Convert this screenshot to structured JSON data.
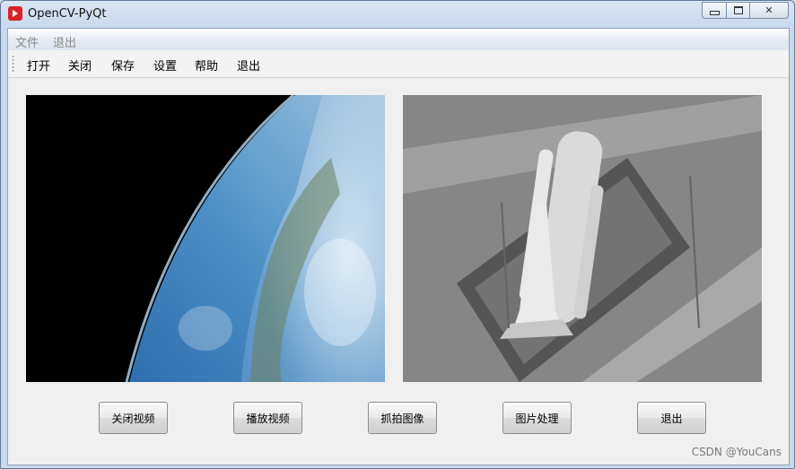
{
  "window": {
    "title": "OpenCV-PyQt"
  },
  "menubar": {
    "items": [
      "文件",
      "退出"
    ]
  },
  "toolbar": {
    "items": [
      "打开",
      "关闭",
      "保存",
      "设置",
      "帮助",
      "退出"
    ]
  },
  "buttons": [
    "关闭视频",
    "播放视频",
    "抓拍图像",
    "图片处理",
    "退出"
  ],
  "watermark": "CSDN @YouCans",
  "colors": {
    "app_icon": "#d8232a",
    "ocean": "#3f7fb8",
    "space": "#000000"
  }
}
